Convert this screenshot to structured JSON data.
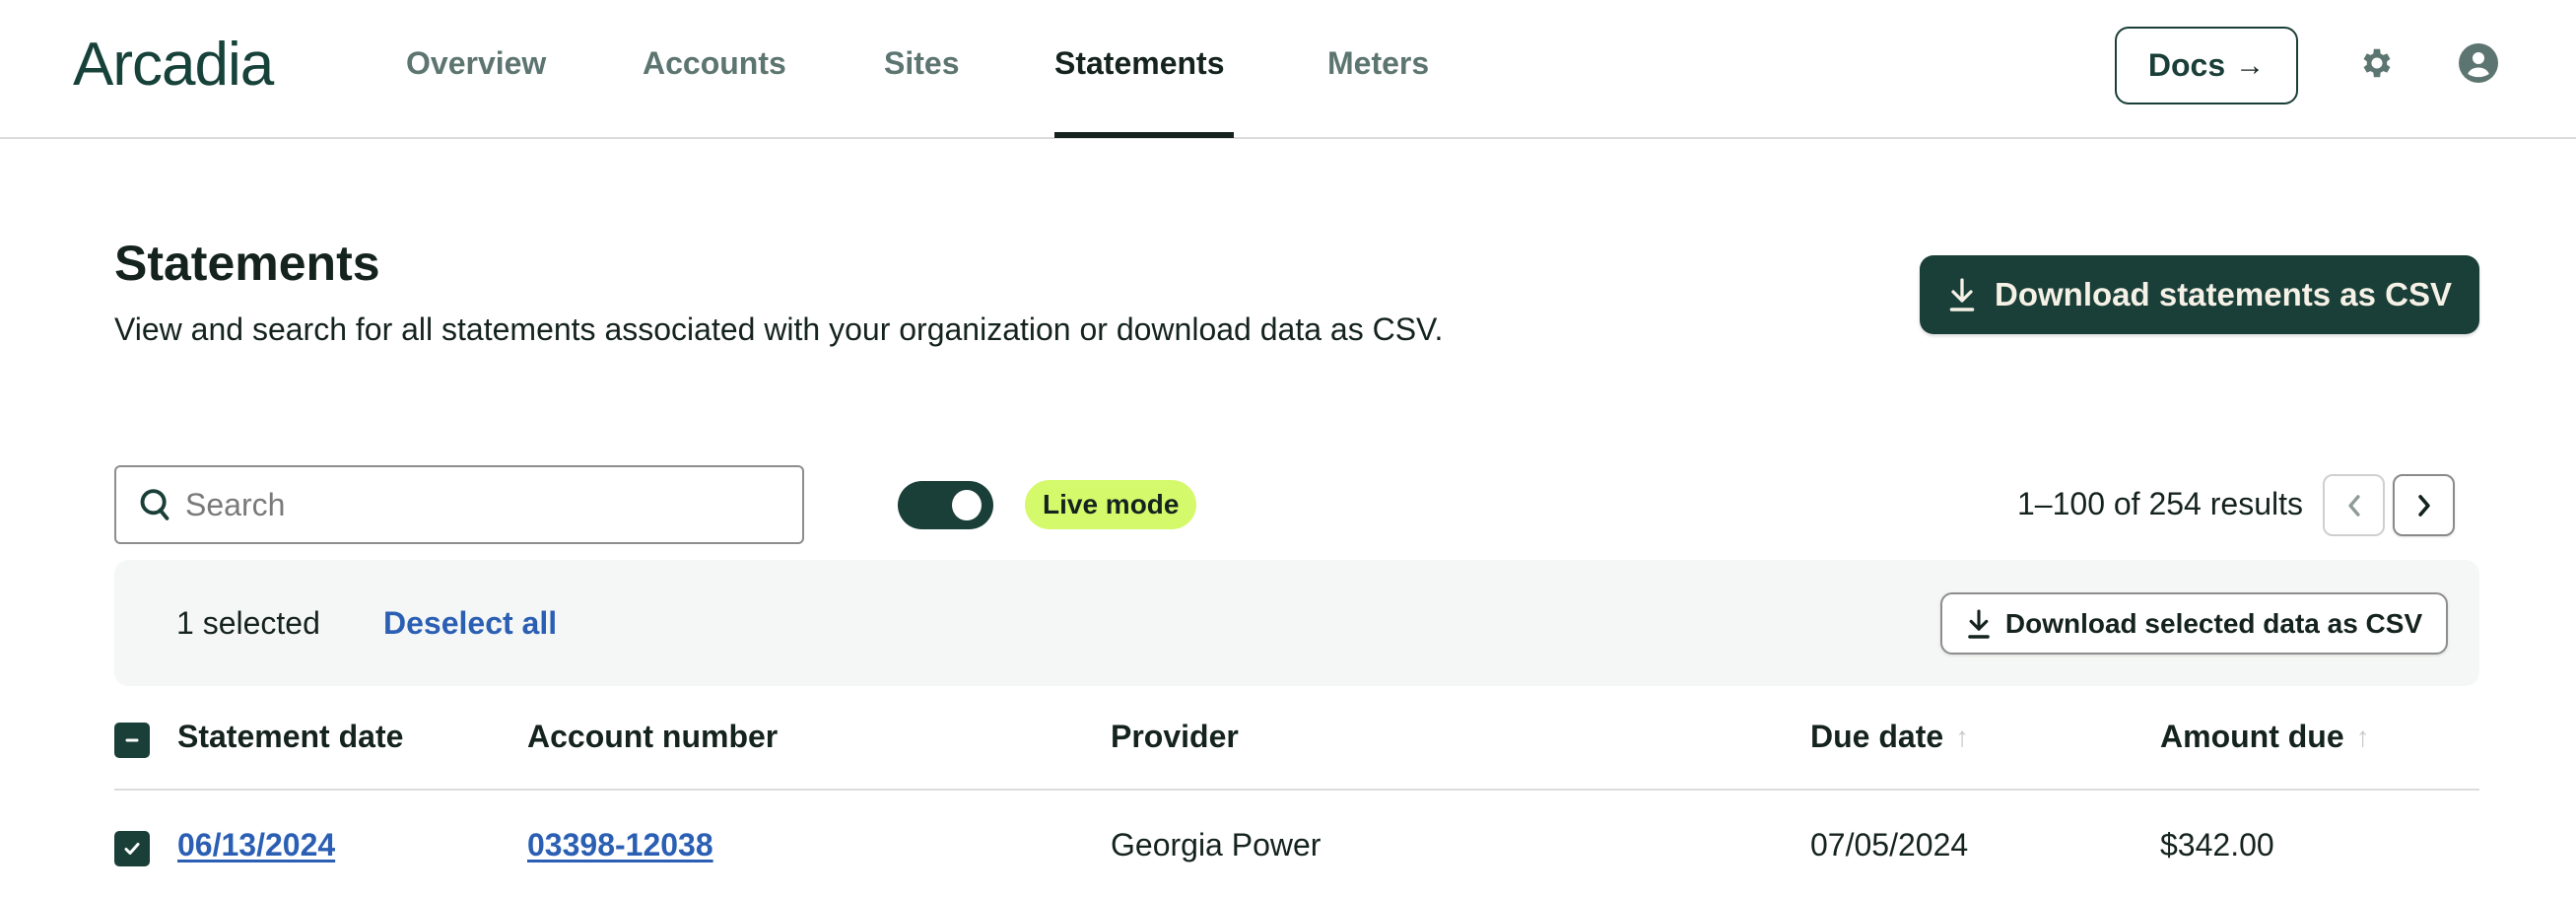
{
  "header": {
    "logo": "Arcadia",
    "nav": [
      {
        "label": "Overview",
        "active": false
      },
      {
        "label": "Accounts",
        "active": false
      },
      {
        "label": "Sites",
        "active": false
      },
      {
        "label": "Statements",
        "active": true
      },
      {
        "label": "Meters",
        "active": false
      }
    ],
    "docs_label": "Docs",
    "docs_arrow": "→",
    "settings_icon": "gear-icon",
    "profile_icon": "user-circle-icon"
  },
  "page": {
    "title": "Statements",
    "subtitle": "View and search for all statements associated with your organization or download data as CSV.",
    "download_all_label": "Download statements as CSV"
  },
  "toolbar": {
    "search_placeholder": "Search",
    "search_value": "",
    "live_mode_on": true,
    "live_mode_label": "Live mode",
    "results_text": "1–100 of 254 results"
  },
  "selection": {
    "count_text": "1 selected",
    "deselect_label": "Deselect all",
    "download_selected_label": "Download selected data as CSV"
  },
  "table": {
    "columns": [
      {
        "label": "Statement date",
        "sortable": false
      },
      {
        "label": "Account number",
        "sortable": false
      },
      {
        "label": "Provider",
        "sortable": false
      },
      {
        "label": "Due date",
        "sortable": true,
        "sort_icon": "↑"
      },
      {
        "label": "Amount due",
        "sortable": true,
        "sort_icon": "↑"
      }
    ],
    "header_checkbox_state": "indeterminate",
    "rows": [
      {
        "selected": true,
        "statement_date": "06/13/2024",
        "account_number": "03398-12038",
        "provider": "Georgia Power",
        "due_date": "07/05/2024",
        "amount_due": "$342.00"
      }
    ]
  },
  "colors": {
    "brand_dark": "#1a3f38",
    "link": "#2b5fb4",
    "live_badge": "#d4f96a",
    "nav_inactive": "#5d7570"
  }
}
